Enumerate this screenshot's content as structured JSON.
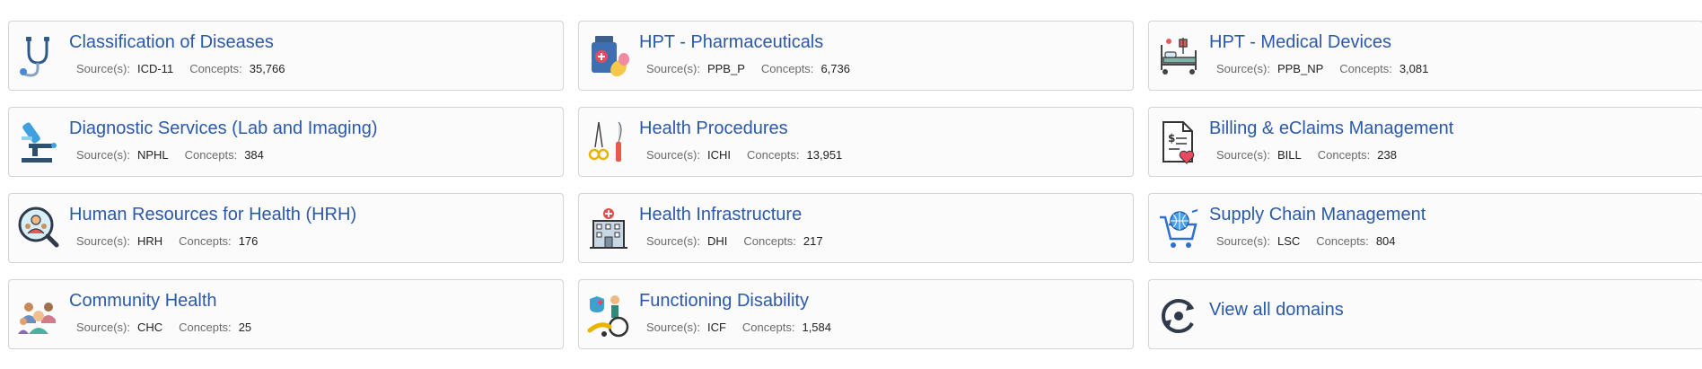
{
  "source_label": "Source(s):",
  "concepts_label": "Concepts:",
  "domains": [
    {
      "title": "Classification of Diseases",
      "source": "ICD-11",
      "concepts": "35,766",
      "icon": "stethoscope-icon"
    },
    {
      "title": "HPT - Pharmaceuticals",
      "source": "PPB_P",
      "concepts": "6,736",
      "icon": "medicine-bottle-icon"
    },
    {
      "title": "HPT - Medical Devices",
      "source": "PPB_NP",
      "concepts": "3,081",
      "icon": "hospital-bed-icon"
    },
    {
      "title": "Diagnostic Services (Lab and Imaging)",
      "source": "NPHL",
      "concepts": "384",
      "icon": "microscope-icon"
    },
    {
      "title": "Health Procedures",
      "source": "ICHI",
      "concepts": "13,951",
      "icon": "surgical-tools-icon"
    },
    {
      "title": "Billing & eClaims Management",
      "source": "BILL",
      "concepts": "238",
      "icon": "invoice-heart-icon"
    },
    {
      "title": "Human Resources for Health (HRH)",
      "source": "HRH",
      "concepts": "176",
      "icon": "people-search-icon"
    },
    {
      "title": "Health Infrastructure",
      "source": "DHI",
      "concepts": "217",
      "icon": "hospital-building-icon"
    },
    {
      "title": "Supply Chain Management",
      "source": "LSC",
      "concepts": "804",
      "icon": "globe-cart-icon"
    },
    {
      "title": "Community Health",
      "source": "CHC",
      "concepts": "25",
      "icon": "community-group-icon"
    },
    {
      "title": "Functioning Disability",
      "source": "ICF",
      "concepts": "1,584",
      "icon": "wheelchair-icon"
    }
  ],
  "view_all": {
    "title": "View all domains",
    "icon": "refresh-cycle-icon"
  }
}
